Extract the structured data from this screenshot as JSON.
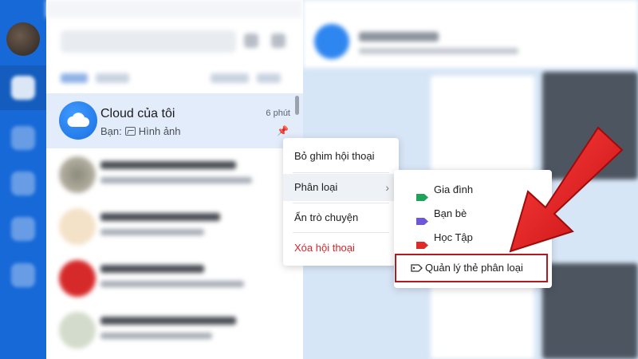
{
  "conversation": {
    "title": "Cloud của tôi",
    "time": "6 phút",
    "sender_label": "Bạn:",
    "preview": "Hình ảnh"
  },
  "context_menu": {
    "items": [
      {
        "label": "Bỏ ghim hội thoại"
      },
      {
        "label": "Phân loại"
      },
      {
        "label": "Ẩn trò chuyện"
      },
      {
        "label": "Xóa hội thoại"
      }
    ]
  },
  "submenu": {
    "items": [
      {
        "label": "Gia đình",
        "color": "#1fa35b"
      },
      {
        "label": "Bạn bè",
        "color": "#6f58d8"
      },
      {
        "label": "Học Tập",
        "color": "#e02a2a"
      }
    ],
    "manage_label": "Quản lý thẻ phân loại"
  },
  "colors": {
    "rail": "#1769d8",
    "highlight_box": "#b41a22",
    "arrow": "#e01b1b"
  }
}
